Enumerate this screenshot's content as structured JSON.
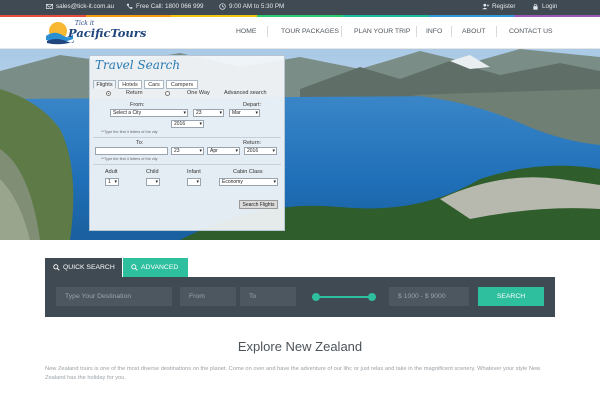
{
  "topbar": {
    "email": "sales@tick-it.com.au",
    "phone": "Free Call: 1800 066 999",
    "hours": "9:00 AM to 5:30 PM",
    "register": "Register",
    "login": "Login"
  },
  "accent_colors": [
    "#e84c3d",
    "#f39c12",
    "#f1c40f",
    "#2ecc71",
    "#1abc9c",
    "#3498db",
    "#9b59b6"
  ],
  "logo": {
    "tick": "Tick it",
    "brand": "PacificTours"
  },
  "nav": {
    "items": [
      "HOME",
      "TOUR PACKAGES",
      "PLAN YOUR TRIP",
      "INFO",
      "ABOUT",
      "CONTACT US"
    ]
  },
  "travel_search": {
    "title": "Travel Search",
    "tabs": [
      "Flights",
      "Hotels",
      "Cars",
      "Campers"
    ],
    "trip_types": [
      "Return",
      "One Way"
    ],
    "advanced_link": "Advanced search",
    "from_label": "From:",
    "depart_label": "Depart:",
    "from_city": "Select a City",
    "depart_day": "23",
    "depart_month": "Mar",
    "depart_year": "2016",
    "city_hint": "**Type the first 4 letters of the city",
    "to_label": "To:",
    "return_label": "Return:",
    "return_day": "23",
    "return_month": "Apr",
    "return_year": "2016",
    "adult_label": "Adult",
    "adult_value": "1",
    "child_label": "Child",
    "child_value": "",
    "infant_label": "Infant",
    "infant_value": "",
    "cabin_label": "Cabin Class",
    "cabin_value": "Economy",
    "submit": "Search Flights"
  },
  "quick_search": {
    "tab_quick": "QUICK SEARCH",
    "tab_advanced": "ADVANCED",
    "destination_placeholder": "Type Your Destination",
    "from_placeholder": "From",
    "to_placeholder": "To",
    "price_range": "$ 1000 - $ 9000",
    "search_button": "SEARCH"
  },
  "explore": {
    "title": "Explore New Zealand",
    "text": "New Zealand tours is one of the most diverse destinations on the planet. Come on over and have the adventure of our life; or just relax and take in the magnificent scenery. Whatever your style New Zealand has the holiday for you."
  },
  "colors": {
    "topbar": "#3f4a52",
    "accent_teal": "#2dbf9e",
    "brand_blue": "#21457d"
  }
}
